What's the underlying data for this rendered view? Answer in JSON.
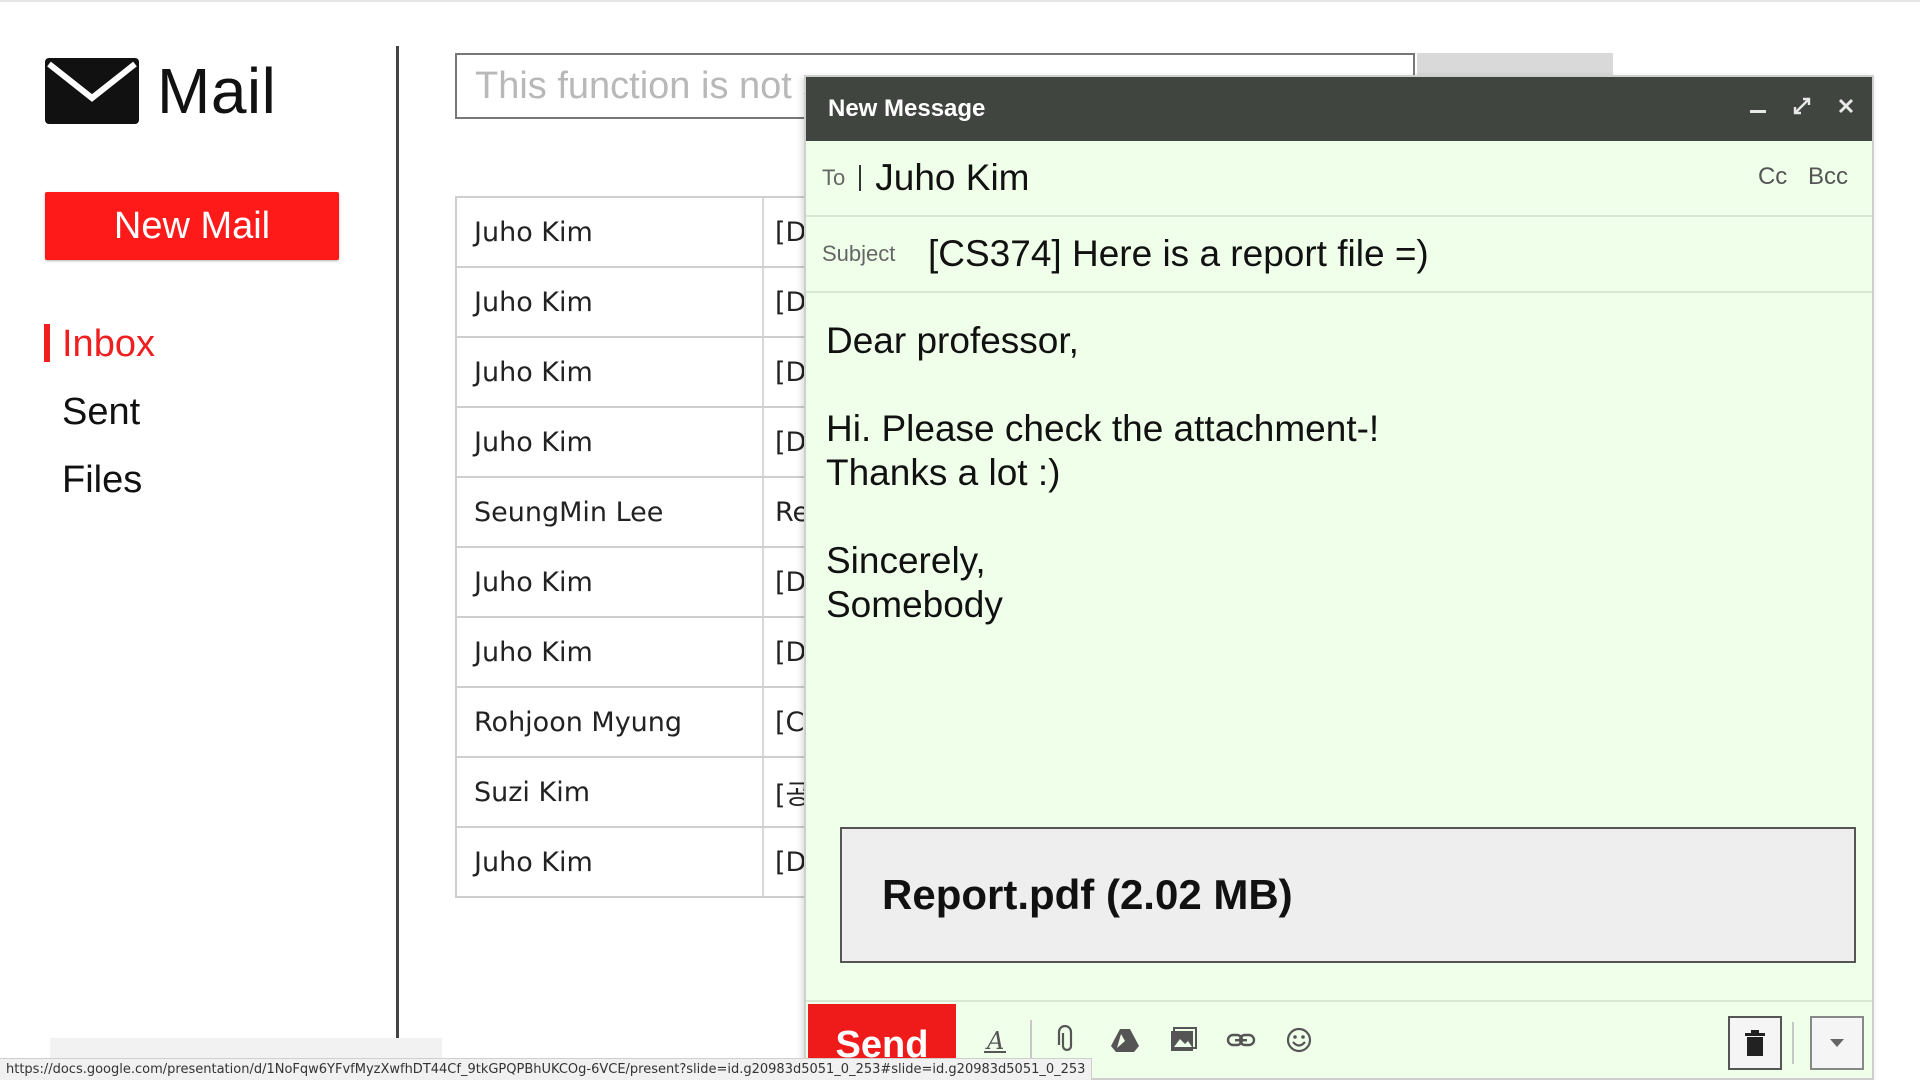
{
  "app": {
    "title": "Mail"
  },
  "sidebar": {
    "new_mail_label": "New Mail",
    "items": [
      {
        "label": "Inbox",
        "active": true
      },
      {
        "label": "Sent",
        "active": false
      },
      {
        "label": "Files",
        "active": false
      }
    ]
  },
  "search": {
    "placeholder": "This function is not s"
  },
  "mail_list": [
    {
      "sender": "Juho Kim",
      "subject": "[D"
    },
    {
      "sender": "Juho Kim",
      "subject": "[D"
    },
    {
      "sender": "Juho Kim",
      "subject": "[D"
    },
    {
      "sender": "Juho Kim",
      "subject": "[D"
    },
    {
      "sender": "SeungMin Lee",
      "subject": "Re"
    },
    {
      "sender": "Juho Kim",
      "subject": "[D"
    },
    {
      "sender": "Juho Kim",
      "subject": "[D"
    },
    {
      "sender": "Rohjoon Myung",
      "subject": "[C"
    },
    {
      "sender": "Suzi Kim",
      "subject": "[공"
    },
    {
      "sender": "Juho Kim",
      "subject": "[D"
    }
  ],
  "compose": {
    "title": "New Message",
    "to_label": "To",
    "to_value": "Juho Kim",
    "cc_label": "Cc",
    "bcc_label": "Bcc",
    "subject_label": "Subject",
    "subject_value": "[CS374] Here is a report file =)",
    "body": {
      "greeting": "Dear professor,",
      "line1": "Hi. Please check the attachment-!",
      "line2": "Thanks a lot :)",
      "closing": "Sincerely,",
      "signature": "Somebody"
    },
    "attachment": "Report.pdf (2.02 MB)",
    "send_label": "Send",
    "header_icons": [
      "minimize-icon",
      "expand-icon",
      "close-icon"
    ],
    "toolbar_icons": [
      "format-text-icon",
      "attach-icon",
      "drive-icon",
      "photo-icon",
      "link-icon",
      "emoji-icon",
      "trash-icon",
      "more-options-icon"
    ]
  },
  "status_bar": {
    "url": "https://docs.google.com/presentation/d/1NoFqw6YFvfMyzXwfhDT44Cf_9tkGPQPBhUKCOg-6VCE/present?slide=id.g20983d5051_0_253#slide=id.g20983d5051_0_253"
  },
  "colors": {
    "accent_red": "#ef1a1a",
    "compose_bg": "#efffe9",
    "compose_header": "#404540"
  }
}
